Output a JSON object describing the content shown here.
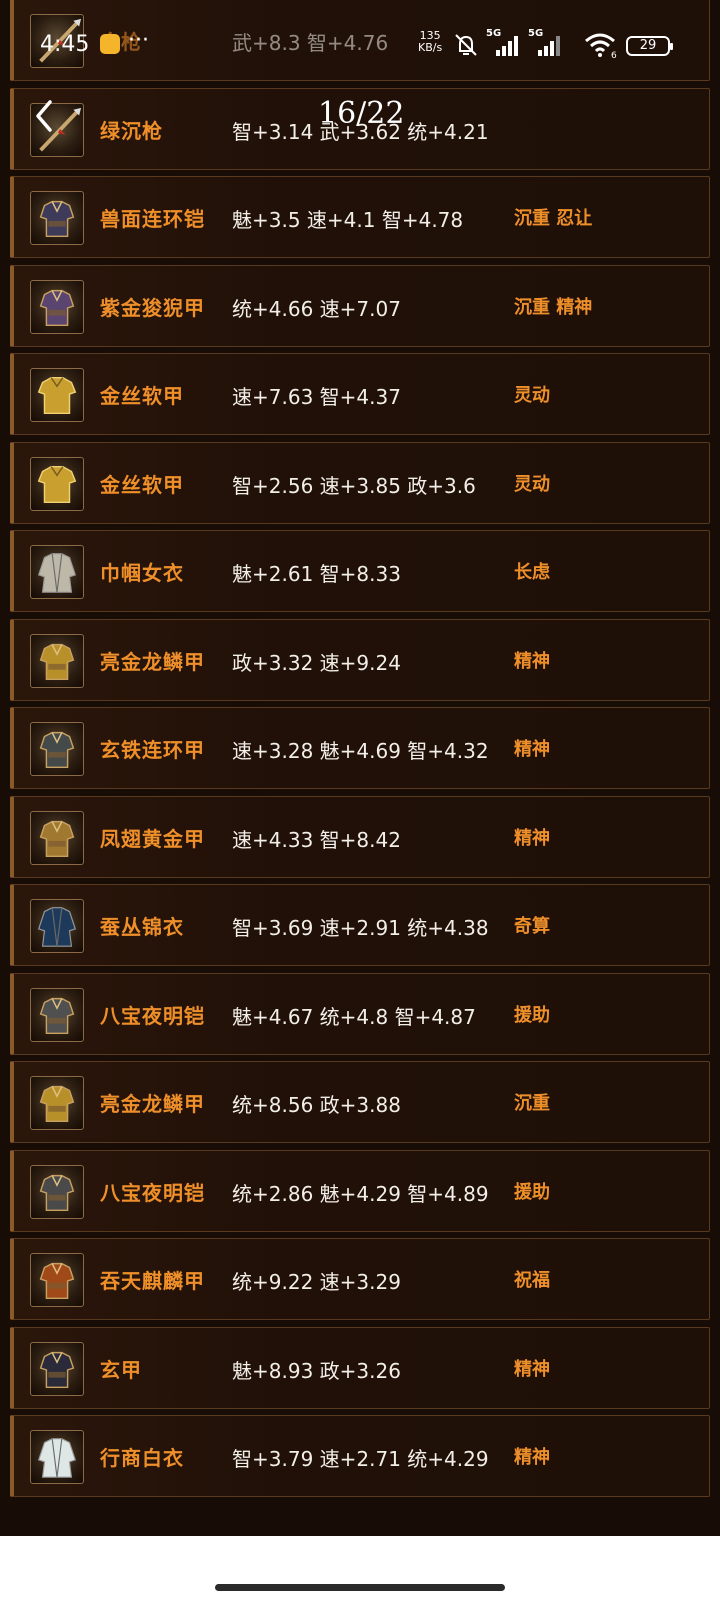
{
  "status_bar": {
    "time": "4:45",
    "more": "···",
    "net_speed_value": "135",
    "net_speed_unit": "KB/s",
    "sim1": "5G",
    "sim2": "5G",
    "wifi_sub": "6",
    "battery": "29"
  },
  "header": {
    "counter": "16/22"
  },
  "items": [
    {
      "name": "金枪",
      "stats": "武+8.3 智+4.76",
      "trait": "",
      "icon": "spear-icon"
    },
    {
      "name": "绿沉枪",
      "stats": "智+3.14 武+3.62 统+4.21",
      "trait": "",
      "icon": "spear-icon"
    },
    {
      "name": "兽面连环铠",
      "stats": "魅+3.5 速+4.1 智+4.78",
      "trait": "沉重 忍让",
      "icon": "armor-icon"
    },
    {
      "name": "紫金狻猊甲",
      "stats": "统+4.66 速+7.07",
      "trait": "沉重 精神",
      "icon": "armor-icon"
    },
    {
      "name": "金丝软甲",
      "stats": "速+7.63 智+4.37",
      "trait": "灵动",
      "icon": "shirt-icon"
    },
    {
      "name": "金丝软甲",
      "stats": "智+2.56 速+3.85 政+3.6",
      "trait": "灵动",
      "icon": "shirt-icon"
    },
    {
      "name": "巾帼女衣",
      "stats": "魅+2.61 智+8.33",
      "trait": "长虑",
      "icon": "robe-icon"
    },
    {
      "name": "亮金龙鳞甲",
      "stats": "政+3.32 速+9.24",
      "trait": "精神",
      "icon": "armor-icon"
    },
    {
      "name": "玄铁连环甲",
      "stats": "速+3.28 魅+4.69 智+4.32",
      "trait": "精神",
      "icon": "armor-icon"
    },
    {
      "name": "凤翅黄金甲",
      "stats": "速+4.33 智+8.42",
      "trait": "精神",
      "icon": "armor-icon"
    },
    {
      "name": "蚕丛锦衣",
      "stats": "智+3.69 速+2.91 统+4.38",
      "trait": "奇算",
      "icon": "robe-icon"
    },
    {
      "name": "八宝夜明铠",
      "stats": "魅+4.67 统+4.8 智+4.87",
      "trait": "援助",
      "icon": "armor-icon"
    },
    {
      "name": "亮金龙鳞甲",
      "stats": "统+8.56 政+3.88",
      "trait": "沉重",
      "icon": "armor-icon"
    },
    {
      "name": "八宝夜明铠",
      "stats": "统+2.86 魅+4.29 智+4.89",
      "trait": "援助",
      "icon": "armor-icon"
    },
    {
      "name": "吞天麒麟甲",
      "stats": "统+9.22 速+3.29",
      "trait": "祝福",
      "icon": "armor-icon"
    },
    {
      "name": "玄甲",
      "stats": "魅+8.93 政+3.26",
      "trait": "精神",
      "icon": "armor-icon"
    },
    {
      "name": "行商白衣",
      "stats": "智+3.79 速+2.71 统+4.29",
      "trait": "精神",
      "icon": "robe-icon"
    }
  ],
  "icon_colors": [
    "#3a2a1a",
    "#3a2a1a",
    "#3e3a5a",
    "#5a4470",
    "#c9a030",
    "#c9a030",
    "#bdb8a8",
    "#b8902a",
    "#444a4a",
    "#a07830",
    "#1e3a5a",
    "#505050",
    "#b8902a",
    "#4a4a4a",
    "#a04a1a",
    "#2a2a3a",
    "#dfe6e6"
  ],
  "colors": {
    "accent": "#ee8f2a",
    "stat_text": "#f2eee8",
    "row_border": "#5a3a1e",
    "background": "#170c06"
  }
}
